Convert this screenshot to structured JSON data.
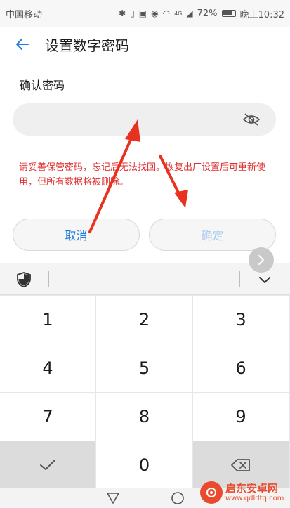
{
  "status_bar": {
    "carrier": "中国移动",
    "network": "4G",
    "battery": "72%",
    "time": "晚上10:32",
    "icons": [
      "bluetooth-icon",
      "vibrate-icon",
      "hd-icon",
      "eye-icon",
      "wifi-icon",
      "signal-icon",
      "battery-icon"
    ]
  },
  "header": {
    "title": "设置数字密码",
    "back_icon": "back-arrow-icon"
  },
  "form": {
    "label": "确认密码",
    "password_value": "",
    "visibility_icon": "eye-off-icon",
    "warning": "请妥善保管密码，忘记后无法找回。恢复出厂设置后可重新使用，但所有数据将被删除。"
  },
  "actions": {
    "cancel_label": "取消",
    "confirm_label": "确定"
  },
  "keyboard": {
    "toolbar_icons": [
      "shield-icon",
      "chevron-down-icon"
    ],
    "keys": [
      "1",
      "2",
      "3",
      "4",
      "5",
      "6",
      "7",
      "8",
      "9",
      "✓",
      "0",
      "⌫"
    ]
  },
  "nav_bar": {
    "icons": [
      "back-triangle-icon",
      "home-circle-icon"
    ]
  },
  "watermark": {
    "title": "启东安卓网",
    "url": "www.qdldtq.com"
  },
  "colors": {
    "accent": "#1f7be0",
    "warning": "#e03131",
    "arrow": "#e8321f",
    "disabled_text": "#a9cbed"
  }
}
